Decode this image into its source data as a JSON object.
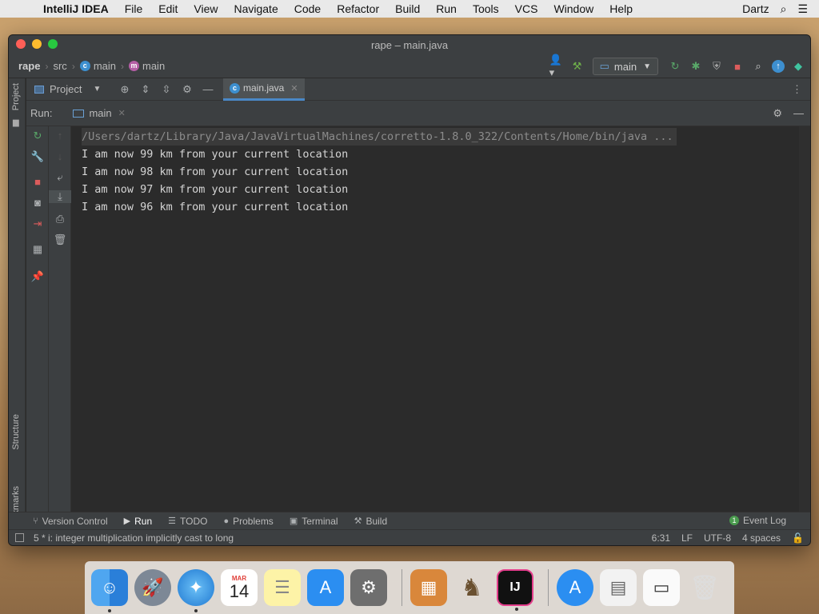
{
  "menubar": {
    "app": "IntelliJ IDEA",
    "items": [
      "File",
      "Edit",
      "View",
      "Navigate",
      "Code",
      "Refactor",
      "Build",
      "Run",
      "Tools",
      "VCS",
      "Window",
      "Help"
    ],
    "user": "Dartz"
  },
  "window": {
    "title": "rape – main.java"
  },
  "navbar": {
    "project": "rape",
    "folder": "src",
    "class": "main",
    "method": "main",
    "run_config": "main"
  },
  "tools": {
    "project_label": "Project",
    "tab_label": "main.java"
  },
  "run": {
    "label": "Run:",
    "tab": "main",
    "command": "/Users/dartz/Library/Java/JavaVirtualMachines/corretto-1.8.0_322/Contents/Home/bin/java ...",
    "lines": [
      "I am now 99 km from your current location",
      "I am now 98 km from your current location",
      "I am now 97 km from your current location",
      "I am now 96 km from your current location"
    ]
  },
  "sidebar": {
    "project": "Project",
    "structure": "Structure",
    "bookmarks": "Bookmarks"
  },
  "bottom_tabs": {
    "version_control": "Version Control",
    "run": "Run",
    "todo": "TODO",
    "problems": "Problems",
    "terminal": "Terminal",
    "build": "Build",
    "event_log": "Event Log",
    "event_count": "1"
  },
  "status": {
    "message": "5 * i: integer multiplication implicitly cast to long",
    "position": "6:31",
    "line_sep": "LF",
    "encoding": "UTF-8",
    "indent": "4 spaces"
  },
  "dock": {
    "calendar_month": "MAR",
    "calendar_day": "14",
    "intellij_label": "IJ"
  }
}
